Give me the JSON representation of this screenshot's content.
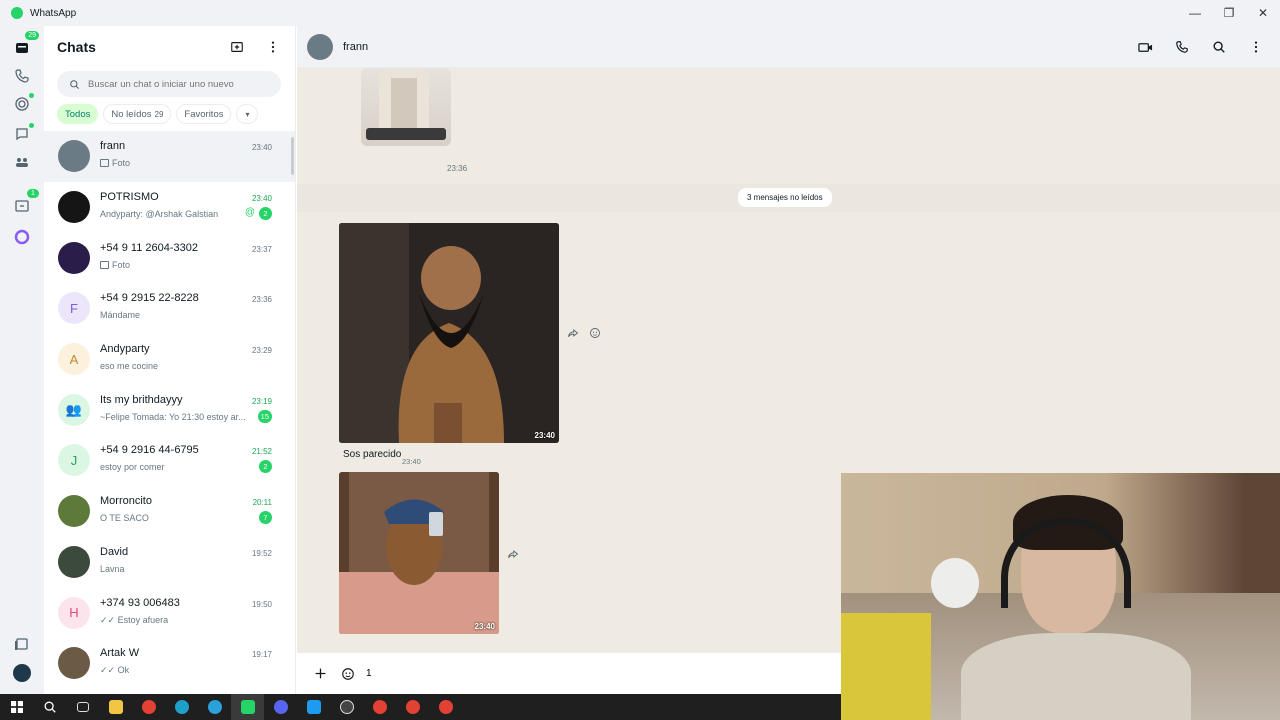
{
  "window": {
    "title": "WhatsApp",
    "controls": [
      "—",
      "❐",
      "✕"
    ]
  },
  "rail": {
    "chats_badge": "29",
    "updates_badge": "1"
  },
  "chatlist": {
    "title": "Chats",
    "search_placeholder": "Buscar un chat o iniciar uno nuevo",
    "filters": [
      {
        "label": "Todos",
        "count": ""
      },
      {
        "label": "No leídos",
        "count": "29"
      },
      {
        "label": "Favoritos",
        "count": ""
      }
    ],
    "chats": [
      {
        "name": "frann",
        "time": "23:40",
        "preview": "Foto",
        "photo": true,
        "badge": "",
        "time_green": false,
        "avatar_color": "#6b7b86",
        "initial": ""
      },
      {
        "name": "POTRISMO",
        "time": "23:40",
        "preview": "Andyparty: @Arshak Galstian",
        "photo": false,
        "badge": "2",
        "mention": true,
        "time_green": true,
        "avatar_color": "#151515",
        "initial": ""
      },
      {
        "name": "+54 9 11 2604-3302",
        "time": "23:37",
        "preview": "Foto",
        "photo": true,
        "badge": "",
        "time_green": false,
        "avatar_color": "#2a1d4a",
        "initial": ""
      },
      {
        "name": "+54 9 2915 22-8228",
        "time": "23:36",
        "preview": "Mándame",
        "photo": false,
        "badge": "",
        "time_green": false,
        "avatar_color": "#ece6fb",
        "initial": "F",
        "initial_color": "#7c5ce0"
      },
      {
        "name": "Andyparty",
        "time": "23:29",
        "preview": "eso me cocine",
        "photo": false,
        "badge": "",
        "time_green": false,
        "avatar_color": "#fcf1dc",
        "initial": "A",
        "initial_color": "#c08a2b"
      },
      {
        "name": "Its my brithdayyy",
        "time": "23:19",
        "preview": "~Felipe Tomada: Yo 21:30 estoy ar...",
        "photo": false,
        "badge": "15",
        "time_green": true,
        "avatar_color": "#dcf6e4",
        "initial": "👥",
        "initial_color": "#25d366"
      },
      {
        "name": "+54 9 2916 44-6795",
        "time": "21:52",
        "preview": "estoy por comer",
        "photo": false,
        "badge": "2",
        "time_green": true,
        "avatar_color": "#dcf6e4",
        "initial": "J",
        "initial_color": "#25a55a"
      },
      {
        "name": "Morroncito",
        "time": "20:11",
        "preview": "O TE SACO",
        "photo": false,
        "badge": "7",
        "time_green": true,
        "avatar_color": "#5d7a3a",
        "initial": ""
      },
      {
        "name": "David",
        "time": "19:52",
        "preview": "Lavna",
        "photo": false,
        "badge": "",
        "time_green": false,
        "avatar_color": "#3c4a3c",
        "initial": ""
      },
      {
        "name": "+374 93 006483",
        "time": "19:50",
        "preview": "✓✓ Estoy afuera",
        "photo": false,
        "badge": "",
        "time_green": false,
        "avatar_color": "#fce4ec",
        "initial": "H",
        "initial_color": "#e0447c"
      },
      {
        "name": "Artak W",
        "time": "19:17",
        "preview": "✓✓ Ok",
        "photo": false,
        "badge": "",
        "time_green": false,
        "avatar_color": "#6b5a45",
        "initial": ""
      }
    ]
  },
  "conversation": {
    "contact_name": "frann",
    "sticker_time": "23:36",
    "unread_label": "3 mensajes no leídos",
    "image1_time": "23:40",
    "caption_text": "Sos parecido",
    "caption_time": "23:40",
    "image2_time": "23:40",
    "composer_value": "1"
  },
  "colors": {
    "accent": "#25d366",
    "chat_bg": "#efeae2",
    "panel": "#f0f2f5"
  }
}
